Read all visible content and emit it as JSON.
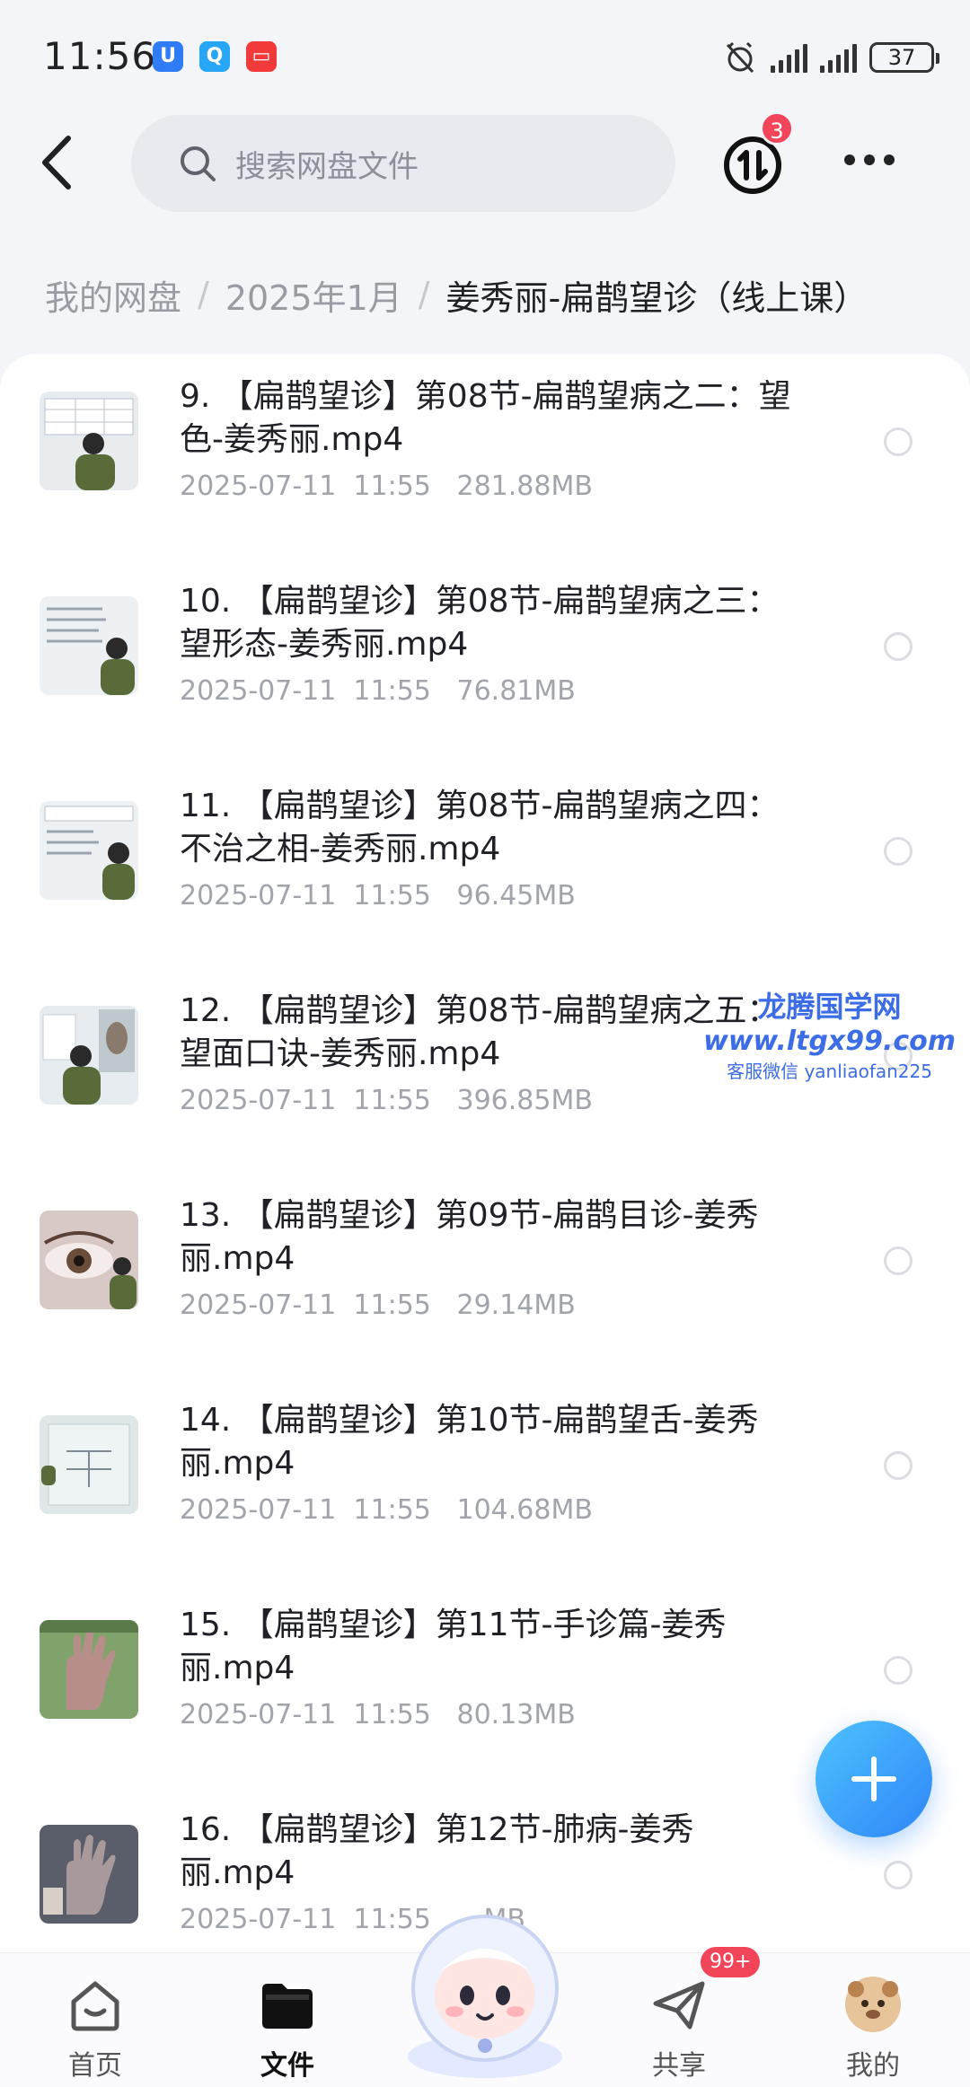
{
  "status_bar": {
    "time": "11:56",
    "battery": "37",
    "app_icons": [
      {
        "icon": "blue-app-icon",
        "glyph": "U",
        "color": "#2f7cf6"
      },
      {
        "icon": "search-app-icon",
        "glyph": "Q",
        "color": "#27a6f5"
      },
      {
        "icon": "red-app-icon",
        "glyph": "▭",
        "color": "#f23a3a"
      }
    ]
  },
  "top_bar": {
    "search_placeholder": "搜索网盘文件",
    "transfer_badge": "3"
  },
  "breadcrumb": [
    "我的网盘",
    "2025年1月",
    "姜秀丽-扁鹊望诊（线上课）"
  ],
  "files": [
    {
      "title": "9. 【扁鹊望诊】第08节-扁鹊望病之二：望色-姜秀丽.mp4",
      "date": "2025-07-11  11:55",
      "size": "281.88MB",
      "thumb": "lecture-chart"
    },
    {
      "title": "10. 【扁鹊望诊】第08节-扁鹊望病之三：望形态-姜秀丽.mp4",
      "date": "2025-07-11  11:55",
      "size": "76.81MB",
      "thumb": "lecture-text"
    },
    {
      "title": "11. 【扁鹊望诊】第08节-扁鹊望病之四：不治之相-姜秀丽.mp4",
      "date": "2025-07-11  11:55",
      "size": "96.45MB",
      "thumb": "lecture-text"
    },
    {
      "title": "12. 【扁鹊望诊】第08节-扁鹊望病之五：望面口诀-姜秀丽.mp4",
      "date": "2025-07-11  11:55",
      "size": "396.85MB",
      "thumb": "lecture-face"
    },
    {
      "title": "13. 【扁鹊望诊】第09节-扁鹊目诊-姜秀丽.mp4",
      "date": "2025-07-11  11:55",
      "size": "29.14MB",
      "thumb": "eye"
    },
    {
      "title": "14. 【扁鹊望诊】第10节-扁鹊望舌-姜秀丽.mp4",
      "date": "2025-07-11  11:55",
      "size": "104.68MB",
      "thumb": "diagram"
    },
    {
      "title": "15. 【扁鹊望诊】第11节-手诊篇-姜秀丽.mp4",
      "date": "2025-07-11  11:55",
      "size": "80.13MB",
      "thumb": "hand"
    },
    {
      "title": "16. 【扁鹊望诊】第12节-肺病-姜秀丽.mp4",
      "date": "2025-07-11  11:55",
      "size": "…MB",
      "thumb": "hand-dark"
    }
  ],
  "watermark": {
    "line1": "龙腾国学网",
    "line2": "www.ltgx99.com",
    "line3": "客服微信 yanliaofan225"
  },
  "bottom_nav": {
    "home": "首页",
    "files": "文件",
    "share": "共享",
    "share_badge": "99+",
    "me": "我的"
  },
  "colors": {
    "accent": "#2f86f8",
    "badge": "#f2455a"
  }
}
